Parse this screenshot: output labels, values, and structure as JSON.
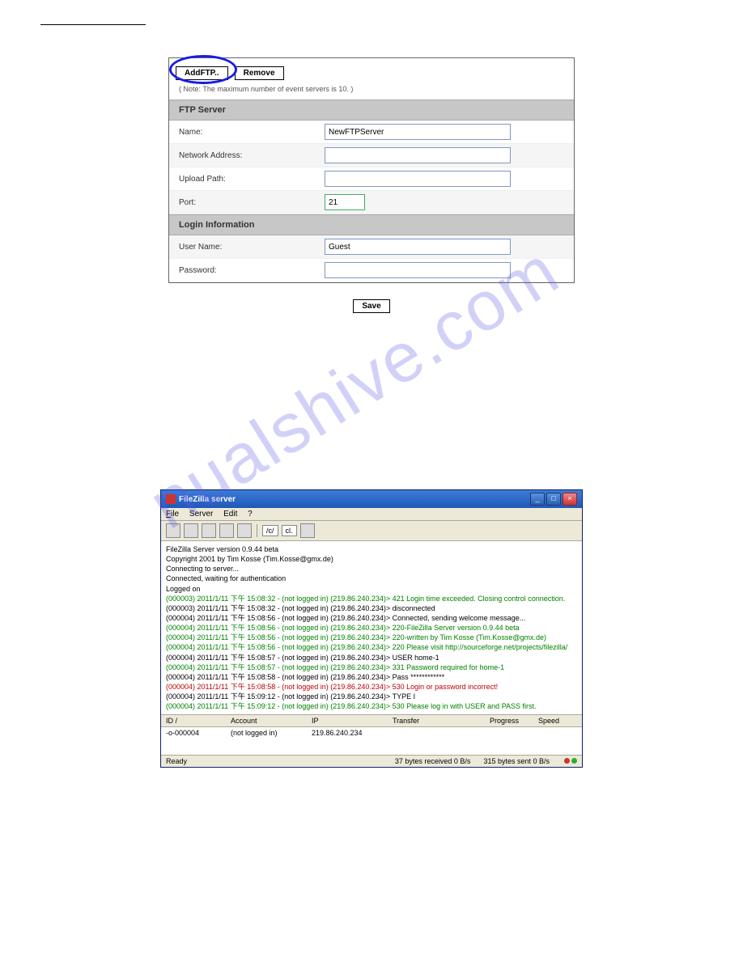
{
  "watermark": "nualshive.com",
  "form": {
    "addBtn": "AddFTP..",
    "removeBtn": "Remove",
    "note": "( Note: The maximum number of event servers is 10. )",
    "section1": "FTP Server",
    "nameLabel": "Name:",
    "nameValue": "NewFTPServer",
    "netLabel": "Network Address:",
    "netValue": "",
    "upLabel": "Upload Path:",
    "upValue": "",
    "portLabel": "Port:",
    "portValue": "21",
    "section2": "Login Information",
    "userLabel": "User Name:",
    "userValue": "Guest",
    "passLabel": "Password:",
    "passValue": "",
    "saveBtn": "Save"
  },
  "xp": {
    "title": "FileZilla server",
    "menu": {
      "file": "File",
      "server": "Server",
      "edit": "Edit",
      "help": "?"
    },
    "tbTxt1": "/c/",
    "tbTxt2": "cl.",
    "log": [
      {
        "cls": "lg-black",
        "txt": "FileZilla Server version 0.9.44 beta"
      },
      {
        "cls": "lg-black",
        "txt": "Copyright 2001 by Tim Kosse (Tim.Kosse@gmx.de)"
      },
      {
        "cls": "lg-black",
        "txt": "Connecting to server..."
      },
      {
        "cls": "lg-black",
        "txt": "Connected, waiting for authentication"
      },
      {
        "cls": "lg-black",
        "txt": "Logged on"
      },
      {
        "cls": "lg-green",
        "txt": "(000003) 2011/1/11 下午 15:08:32 - (not logged in) (219.86.240.234)> 421 Login time exceeded. Closing control connection."
      },
      {
        "cls": "lg-black",
        "txt": "(000003) 2011/1/11 下午 15:08:32 - (not logged in) (219.86.240.234)> disconnected"
      },
      {
        "cls": "lg-black",
        "txt": "(000004) 2011/1/11 下午 15:08:56 - (not logged in) (219.86.240.234)> Connected, sending welcome message..."
      },
      {
        "cls": "lg-green",
        "txt": "(000004) 2011/1/11 下午 15:08:56 - (not logged in) (219.86.240.234)> 220-FileZilla Server version 0.9.44 beta"
      },
      {
        "cls": "lg-green",
        "txt": "(000004) 2011/1/11 下午 15:08:56 - (not logged in) (219.86.240.234)> 220-written by Tim Kosse (Tim.Kosse@gmx.de)"
      },
      {
        "cls": "lg-green",
        "txt": "(000004) 2011/1/11 下午 15:08:56 - (not logged in) (219.86.240.234)> 220 Please visit http://sourceforge.net/projects/filezilla/"
      },
      {
        "cls": "lg-black",
        "txt": "(000004) 2011/1/11 下午 15:08:57 - (not logged in) (219.86.240.234)> USER home-1"
      },
      {
        "cls": "lg-green",
        "txt": "(000004) 2011/1/11 下午 15:08:57 - (not logged in) (219.86.240.234)> 331 Password required for home-1"
      },
      {
        "cls": "lg-black",
        "txt": "(000004) 2011/1/11 下午 15:08:58 - (not logged in) (219.86.240.234)> Pass ************"
      },
      {
        "cls": "lg-red",
        "txt": "(000004) 2011/1/11 下午 15:08:58 - (not logged in) (219.86.240.234)> 530 Login or password incorrect!"
      },
      {
        "cls": "lg-black",
        "txt": "(000004) 2011/1/11 下午 15:09:12 - (not logged in) (219.86.240.234)> TYPE I"
      },
      {
        "cls": "lg-green",
        "txt": "(000004) 2011/1/11 下午 15:09:12 - (not logged in) (219.86.240.234)> 530 Please log in with USER and PASS first."
      }
    ],
    "connHead": {
      "id": "ID  /",
      "acct": "Account",
      "ip": "IP",
      "xfer": "Transfer",
      "prog": "Progress",
      "speed": "Speed"
    },
    "connRow": {
      "id": "-o-000004",
      "acct": "(not logged in)",
      "ip": "219.86.240.234"
    },
    "status": {
      "ready": "Ready",
      "recv": "37 bytes received  0 B/s",
      "sent": "315 bytes sent  0 B/s"
    }
  }
}
